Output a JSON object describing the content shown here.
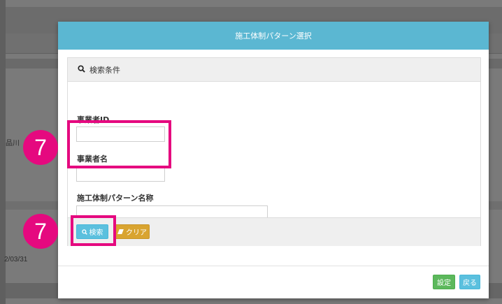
{
  "modal": {
    "title": "施工体制パターン選択",
    "panel_title": "検索条件",
    "search_icon": "search-icon",
    "fields": {
      "operator_id_label": "事業者ID",
      "operator_id_value": "",
      "operator_name_label": "事業者名",
      "operator_name_value": "",
      "pattern_name_label": "施工体制パターン名称",
      "pattern_name_value": ""
    },
    "buttons": {
      "search": "検索",
      "clear": "クリア",
      "ok": "設定",
      "back": "戻る"
    }
  },
  "background": {
    "fragment_text": "品川",
    "date_fragment": "2/03/31"
  },
  "annotations": {
    "badge_1": "7",
    "badge_2": "7",
    "color": "#e5097f"
  },
  "colors": {
    "header": "#5bb7d2",
    "search_button": "#5bc0de",
    "clear_button": "#d9a430",
    "ok_button": "#5cb85c",
    "back_button": "#5bc0de"
  }
}
